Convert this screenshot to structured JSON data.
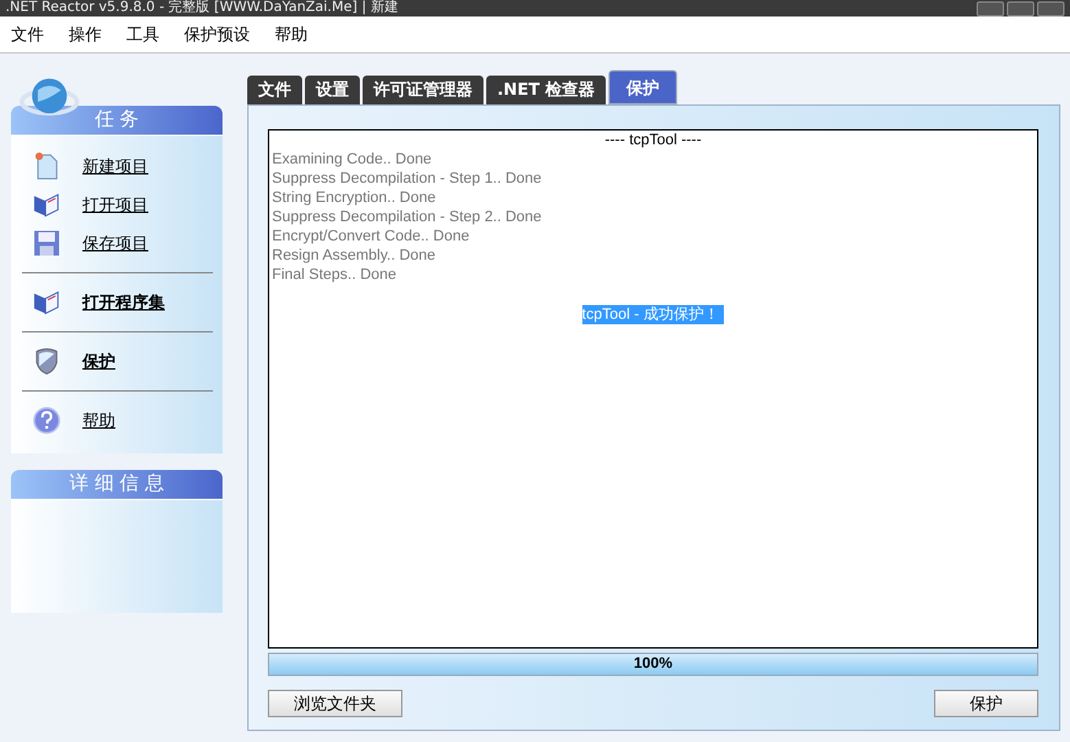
{
  "window": {
    "title": ".NET Reactor v5.9.8.0 - 完整版 [WWW.DaYanZai.Me]  |  新建"
  },
  "menu": [
    "文件",
    "操作",
    "工具",
    "保护预设",
    "帮助"
  ],
  "sidebar": {
    "tasks_title": "任 务",
    "items": [
      {
        "label": "新建项目",
        "kind": "new",
        "bold": false,
        "separator_before": false
      },
      {
        "label": "打开项目",
        "kind": "open",
        "bold": false,
        "separator_before": false
      },
      {
        "label": "保存项目",
        "kind": "save",
        "bold": false,
        "separator_before": false
      },
      {
        "label": "打开程序集",
        "kind": "open",
        "bold": true,
        "separator_before": true
      },
      {
        "label": "保护",
        "kind": "shield",
        "bold": true,
        "separator_before": true
      },
      {
        "label": "帮助",
        "kind": "help",
        "bold": false,
        "separator_before": true
      }
    ],
    "details_title": "详 细 信 息"
  },
  "tabs": [
    {
      "label": "文件",
      "selected": false
    },
    {
      "label": "设置",
      "selected": false
    },
    {
      "label": "许可证管理器",
      "selected": false
    },
    {
      "label": ".NET 检查器",
      "selected": false
    },
    {
      "label": "保护",
      "selected": true
    }
  ],
  "log": {
    "header": "---- tcpTool ----",
    "lines": [
      "Examining Code.. Done",
      "Suppress Decompilation - Step 1.. Done",
      "String Encryption.. Done",
      "Suppress Decompilation - Step 2.. Done",
      "Encrypt/Convert Code.. Done",
      "Resign Assembly.. Done",
      "Final Steps.. Done"
    ],
    "result": "tcpTool - 成功保护！"
  },
  "progress": {
    "level": 1,
    "text": "100%"
  },
  "buttons": {
    "browse": "浏览文件夹",
    "protect": "保护"
  }
}
